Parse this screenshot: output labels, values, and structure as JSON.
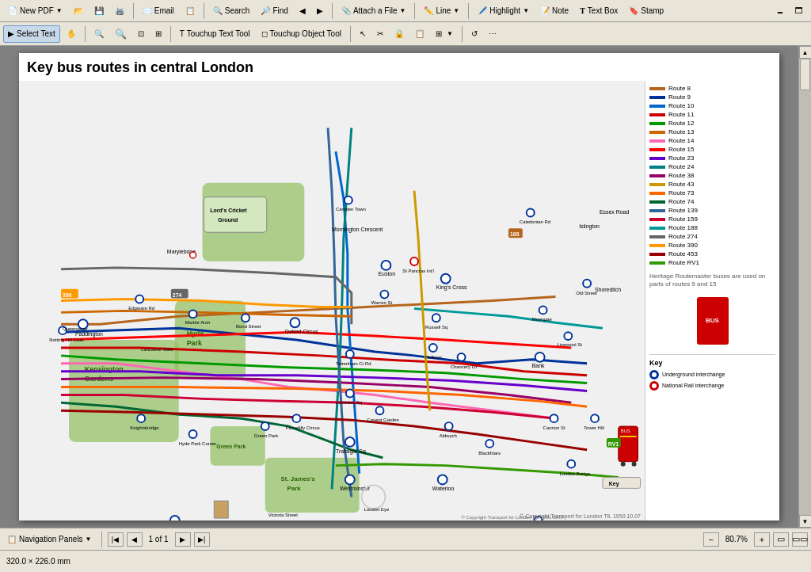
{
  "toolbar_top": {
    "buttons": [
      {
        "id": "new-pdf",
        "label": "New PDF",
        "icon": "📄"
      },
      {
        "id": "open",
        "label": "",
        "icon": "📂"
      },
      {
        "id": "save",
        "label": "",
        "icon": "💾"
      },
      {
        "id": "print",
        "label": "",
        "icon": "🖨️"
      },
      {
        "id": "email",
        "label": "Email",
        "icon": "✉️"
      },
      {
        "id": "create",
        "label": "",
        "icon": "📋"
      },
      {
        "id": "search",
        "label": "Search",
        "icon": "🔍"
      },
      {
        "id": "find",
        "label": "Find",
        "icon": "🔎"
      },
      {
        "id": "nav1",
        "label": "",
        "icon": "◀"
      },
      {
        "id": "nav2",
        "label": "",
        "icon": "▶"
      },
      {
        "id": "attach",
        "label": "Attach a File",
        "icon": "📎"
      },
      {
        "id": "line",
        "label": "Line",
        "icon": "✏️"
      },
      {
        "id": "highlight",
        "label": "Highlight",
        "icon": "🖊️"
      },
      {
        "id": "note",
        "label": "Note",
        "icon": "📝"
      },
      {
        "id": "textbox",
        "label": "Text Box",
        "icon": "T"
      },
      {
        "id": "stamp",
        "label": "Stamp",
        "icon": "🔖"
      }
    ]
  },
  "toolbar_middle": {
    "buttons": [
      {
        "id": "select-text",
        "label": "Select Text",
        "icon": "I"
      },
      {
        "id": "hand",
        "label": "",
        "icon": "✋"
      },
      {
        "id": "zoom-in",
        "label": "",
        "icon": "🔍"
      },
      {
        "id": "zoom-out",
        "label": "",
        "icon": "🔍"
      },
      {
        "id": "zoom-fit",
        "label": "",
        "icon": "⊡"
      },
      {
        "id": "touchup-text",
        "label": "Touchup Text Tool",
        "icon": "T"
      },
      {
        "id": "touchup-obj",
        "label": "Touchup Object Tool",
        "icon": "◻"
      },
      {
        "id": "sel-arrow",
        "label": "",
        "icon": "↖"
      },
      {
        "id": "button-tool",
        "label": "Button Tool",
        "icon": "⊞"
      },
      {
        "id": "refresh",
        "label": "",
        "icon": "↺"
      },
      {
        "id": "more",
        "label": "",
        "icon": "⋯"
      }
    ]
  },
  "document": {
    "title": "Key bus routes in central London",
    "page": "1 of 1",
    "zoom": "80.7%",
    "dimensions": "320.0 × 226.0 mm",
    "copyright": "© Copyright Transport for London    TfL 1950.10.07"
  },
  "legend": {
    "title": "Key",
    "routes": [
      {
        "number": "Route 8",
        "color": "#b5651d"
      },
      {
        "number": "Route 9",
        "color": "#003399"
      },
      {
        "number": "Route 10",
        "color": "#0066cc"
      },
      {
        "number": "Route 11",
        "color": "#cc0000"
      },
      {
        "number": "Route 12",
        "color": "#009900"
      },
      {
        "number": "Route 13",
        "color": "#cc6600"
      },
      {
        "number": "Route 14",
        "color": "#ff69b4"
      },
      {
        "number": "Route 15",
        "color": "#ff0000"
      },
      {
        "number": "Route 23",
        "color": "#6600cc"
      },
      {
        "number": "Route 24",
        "color": "#008080"
      },
      {
        "number": "Route 38",
        "color": "#990066"
      },
      {
        "number": "Route 43",
        "color": "#cc9900"
      },
      {
        "number": "Route 73",
        "color": "#ff6600"
      },
      {
        "number": "Route 74",
        "color": "#006633"
      },
      {
        "number": "Route 139",
        "color": "#336699"
      },
      {
        "number": "Route 159",
        "color": "#cc0033"
      },
      {
        "number": "Route 188",
        "color": "#009999"
      },
      {
        "number": "Route 274",
        "color": "#666666"
      },
      {
        "number": "Route 390",
        "color": "#ff9900"
      },
      {
        "number": "Route 453",
        "color": "#990000"
      },
      {
        "number": "Route RV1",
        "color": "#339900"
      }
    ],
    "key_items": [
      {
        "symbol": "●",
        "color": "#003399",
        "label": "Underground interchange"
      },
      {
        "symbol": "■",
        "color": "#cc0000",
        "label": "National Rail interchange"
      }
    ],
    "note": "Heritage Routemaster buses are used on parts of routes 9 and 15"
  },
  "navigation": {
    "panel_label": "Navigation Panels",
    "page_current": "1 of 1",
    "zoom_level": "80.7%"
  },
  "scrollbar": {
    "up_arrow": "▲",
    "down_arrow": "▼"
  },
  "bottom_toolbar": {
    "coords": "320.0 × 226.0 mm"
  }
}
